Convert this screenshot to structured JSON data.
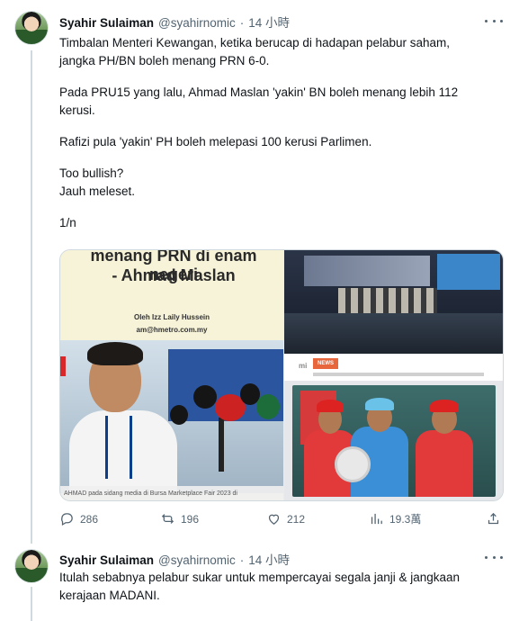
{
  "tweets": [
    {
      "author": {
        "name": "Syahir Sulaiman",
        "handle": "@syahirnomic",
        "separator": "·",
        "time": "14 小時"
      },
      "paragraphs": [
        "Timbalan Menteri Kewangan, ketika berucap di hadapan pelabur saham,\njangka PH/BN boleh menang PRN 6-0.",
        "Pada PRU15 yang lalu, Ahmad Maslan 'yakin' BN boleh menang lebih 112\nkerusi.",
        "Rafizi pula 'yakin' PH boleh melepasi 100 kerusi Parlimen.",
        "Too bullish?\nJauh meleset.",
        "1/n"
      ],
      "media": {
        "left_image": {
          "headline_line1": "menang PRN di enam negeri",
          "headline_line2": "- Ahmad Maslan",
          "byline_author": "Oleh Izz Laily Hussein",
          "byline_email": "am@hmetro.com.my",
          "caption": "AHMAD pada sidang media di Bursa Marketplace Fair 2023 di"
        },
        "right_image": {
          "logo": "mi",
          "tag": "NEWS"
        }
      },
      "actions": {
        "reply_count": "286",
        "retweet_count": "196",
        "like_count": "212",
        "view_count": "19.3萬"
      }
    },
    {
      "author": {
        "name": "Syahir Sulaiman",
        "handle": "@syahirnomic",
        "separator": "·",
        "time": "14 小時"
      },
      "paragraphs": [
        "Itulah sebabnya pelabur sukar untuk mempercayai segala janji & jangkaan\nkerajaan MADANI."
      ]
    }
  ],
  "colors": {
    "text_primary": "#0f1419",
    "text_secondary": "#536471",
    "thread_line": "#cfd9de"
  },
  "icons": [
    "reply-icon",
    "retweet-icon",
    "like-icon",
    "views-icon",
    "share-icon",
    "more-icon"
  ]
}
